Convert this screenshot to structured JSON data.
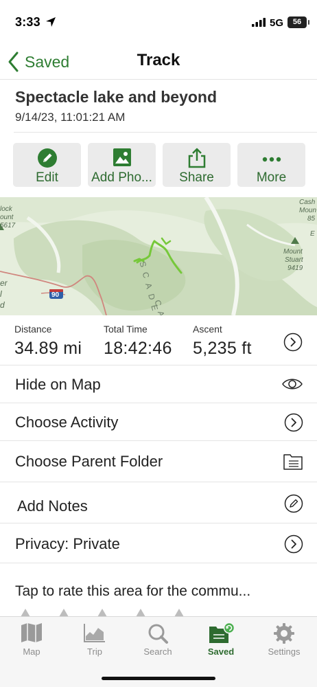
{
  "status_bar": {
    "time": "3:33",
    "network": "5G",
    "battery": "56"
  },
  "nav": {
    "back_label": "Saved",
    "title": "Track"
  },
  "track": {
    "name": "Spectacle lake and beyond",
    "date": "9/14/23, 11:01:21 AM"
  },
  "actions": [
    {
      "label": "Edit",
      "icon": "pencil-icon"
    },
    {
      "label": "Add Pho...",
      "icon": "photo-icon"
    },
    {
      "label": "Share",
      "icon": "share-icon"
    },
    {
      "label": "More",
      "icon": "more-dots-icon"
    }
  ],
  "map": {
    "labels": {
      "left_top_1": "lock",
      "left_top_2": "ount",
      "left_top_3": "5617",
      "right_top_1": "Cash",
      "right_top_2": "Moun",
      "right_top_3": "85",
      "right_e": "E",
      "peak_name_1": "Mount",
      "peak_name_2": "Stuart",
      "peak_elev": "9419",
      "left_mid_1": "er",
      "left_mid_2": "l",
      "left_mid_3": "d",
      "cascade_1": "SCADE",
      "cascade_2": "CA",
      "highway": "90"
    },
    "colors": {
      "track": "#76c83a",
      "highway": "#d0867e",
      "terrain": "#e6eedd"
    }
  },
  "stats": {
    "distance": {
      "label": "Distance",
      "value": "34.89 mi"
    },
    "total_time": {
      "label": "Total Time",
      "value": "18:42:46"
    },
    "ascent": {
      "label": "Ascent",
      "value": "5,235 ft"
    }
  },
  "rows": [
    {
      "label": "Hide on Map",
      "icon": "eye-icon"
    },
    {
      "label": "Choose Activity",
      "icon": "chevron-right-circle-icon"
    },
    {
      "label": "Choose Parent Folder",
      "icon": "folder-icon"
    },
    {
      "label": "Add Notes",
      "icon": "pencil-circle-icon"
    },
    {
      "label": "Privacy: Private",
      "icon": "chevron-right-circle-icon"
    }
  ],
  "rating": {
    "prompt": "Tap to rate this area for the commu..."
  },
  "tabs": [
    {
      "label": "Map",
      "icon": "map-icon",
      "active": false
    },
    {
      "label": "Trip",
      "icon": "trip-chart-icon",
      "active": false
    },
    {
      "label": "Search",
      "icon": "search-icon",
      "active": false
    },
    {
      "label": "Saved",
      "icon": "saved-folder-icon",
      "active": true
    },
    {
      "label": "Settings",
      "icon": "gear-icon",
      "active": false
    }
  ],
  "colors": {
    "accent": "#2e7d32",
    "accent_dark": "#2e6b30",
    "button_bg": "#ebebeb",
    "tab_inactive": "#8c8c8c"
  }
}
